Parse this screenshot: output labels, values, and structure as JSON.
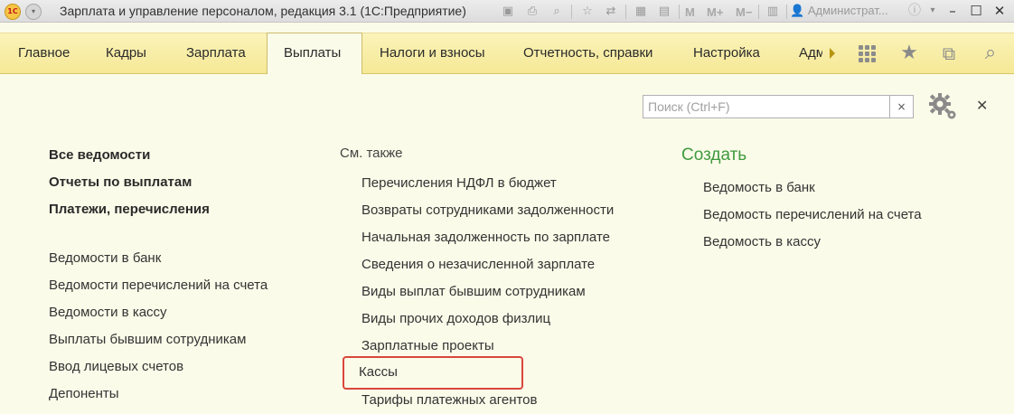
{
  "window": {
    "title": "Зарплата и управление персоналом, редакция 3.1  (1С:Предприятие)",
    "logo_text": "1С",
    "user": "Администрат...",
    "memory_buttons": [
      "M",
      "M+",
      "M−"
    ]
  },
  "sections": [
    {
      "label": "Главное",
      "active": false
    },
    {
      "label": "Кадры",
      "active": false
    },
    {
      "label": "Зарплата",
      "active": false
    },
    {
      "label": "Выплаты",
      "active": true
    },
    {
      "label": "Налоги и взносы",
      "active": false
    },
    {
      "label": "Отчетность, справки",
      "active": false
    },
    {
      "label": "Настройка",
      "active": false
    },
    {
      "label": "Адм",
      "active": false
    }
  ],
  "search": {
    "placeholder": "Поиск (Ctrl+F)",
    "clear_icon": "×"
  },
  "left_column": {
    "bold_items": [
      "Все ведомости",
      "Отчеты по выплатам",
      "Платежи, перечисления"
    ],
    "items": [
      "Ведомости в банк",
      "Ведомости перечислений на счета",
      "Ведомости в кассу",
      "Выплаты бывшим сотрудникам",
      "Ввод лицевых счетов",
      "Депоненты"
    ]
  },
  "see_also": {
    "title": "См. также",
    "items": [
      "Перечисления НДФЛ в бюджет",
      "Возвраты сотрудниками задолженности",
      "Начальная задолженность по зарплате",
      "Сведения о незачисленной зарплате",
      "Виды выплат бывшим сотрудникам",
      "Виды прочих доходов физлиц",
      "Зарплатные проекты",
      "Кассы",
      "Тарифы платежных агентов"
    ],
    "highlighted": "Кассы"
  },
  "create": {
    "title": "Создать",
    "items": [
      "Ведомость в банк",
      "Ведомость перечислений на счета",
      "Ведомость в кассу"
    ]
  },
  "colors": {
    "tab_bar": "#f5e896",
    "content_bg": "#fbfbe9",
    "create_heading": "#3f9a3f",
    "highlight": "#d9473c"
  }
}
